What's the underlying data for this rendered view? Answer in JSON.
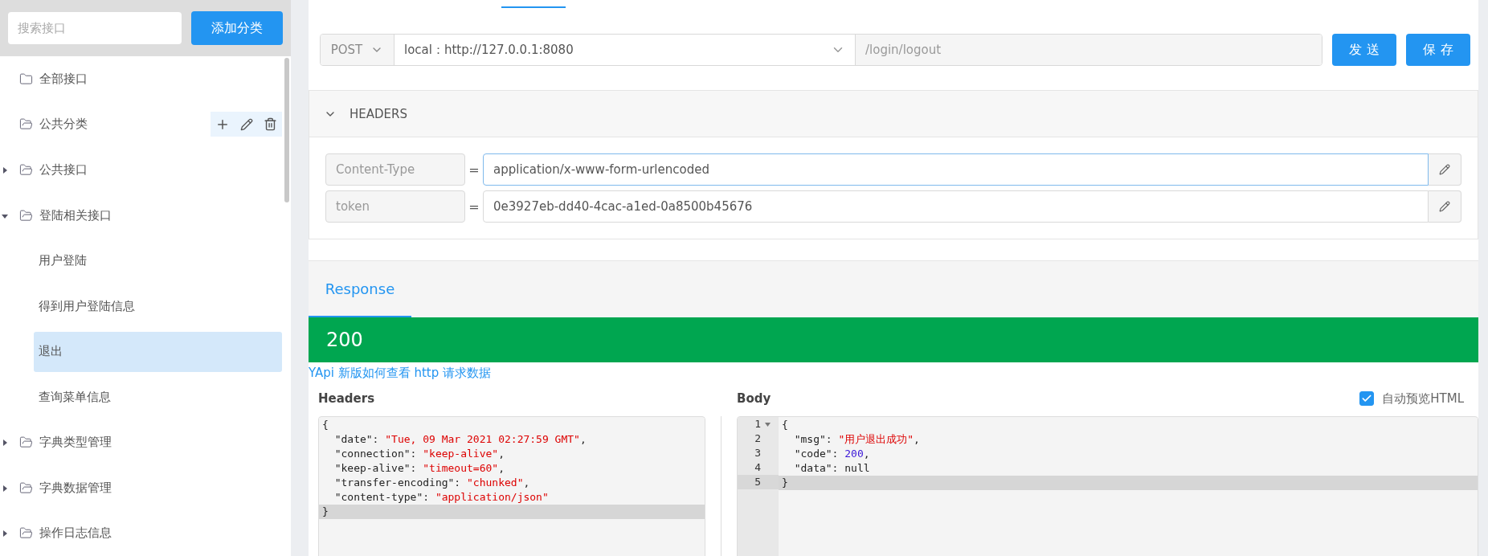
{
  "sidebar": {
    "search": {
      "placeholder": "搜索接口"
    },
    "add_button": "添加分类",
    "tree": [
      {
        "label": "全部接口",
        "kind": "all",
        "selected": false
      },
      {
        "label": "公共分类",
        "kind": "category",
        "selected": false,
        "hovered": true
      },
      {
        "label": "公共接口",
        "kind": "category",
        "selected": false,
        "expanded": false
      },
      {
        "label": "登陆相关接口",
        "kind": "category",
        "selected": false,
        "expanded": true,
        "children": [
          {
            "label": "用户登陆",
            "selected": false
          },
          {
            "label": "得到用户登陆信息",
            "selected": false
          },
          {
            "label": "退出",
            "selected": true
          },
          {
            "label": "查询菜单信息",
            "selected": false
          }
        ]
      },
      {
        "label": "字典类型管理",
        "kind": "category",
        "selected": false,
        "expanded": false
      },
      {
        "label": "字典数据管理",
        "kind": "category",
        "selected": false,
        "expanded": false
      },
      {
        "label": "操作日志信息",
        "kind": "category",
        "selected": false,
        "expanded": false
      }
    ]
  },
  "request": {
    "method": "POST",
    "environment": "local：http://127.0.0.1:8080",
    "path": "/login/logout",
    "buttons": [
      "发 送",
      "保 存"
    ]
  },
  "headers": {
    "title": "HEADERS",
    "expanded": true,
    "rows": [
      {
        "name": "Content-Type",
        "separator": "=",
        "value": "application/x-www-form-urlencoded",
        "focused": true
      },
      {
        "name": "token",
        "separator": "=",
        "value": "0e3927eb-dd40-4cac-a1ed-0a8500b45676",
        "focused": false
      }
    ]
  },
  "response": {
    "tab": {
      "label": "Response",
      "selected": true
    },
    "status": "200",
    "help_link": "YApi 新版如何查看 http 请求数据",
    "headers_title": "Headers",
    "headers_code": [
      {
        "active": false,
        "tokens": [
          {
            "kind": "plain",
            "text": "{"
          }
        ]
      },
      {
        "active": false,
        "tokens": [
          {
            "kind": "plain",
            "text": "  \"date\": "
          },
          {
            "kind": "string",
            "text": "\"Tue, 09 Mar 2021 02:27:59 GMT\""
          },
          {
            "kind": "plain",
            "text": ","
          }
        ]
      },
      {
        "active": false,
        "tokens": [
          {
            "kind": "plain",
            "text": "  \"connection\": "
          },
          {
            "kind": "string",
            "text": "\"keep-alive\""
          },
          {
            "kind": "plain",
            "text": ","
          }
        ]
      },
      {
        "active": false,
        "tokens": [
          {
            "kind": "plain",
            "text": "  \"keep-alive\": "
          },
          {
            "kind": "string",
            "text": "\"timeout=60\""
          },
          {
            "kind": "plain",
            "text": ","
          }
        ]
      },
      {
        "active": false,
        "tokens": [
          {
            "kind": "plain",
            "text": "  \"transfer-encoding\": "
          },
          {
            "kind": "string",
            "text": "\"chunked\""
          },
          {
            "kind": "plain",
            "text": ","
          }
        ]
      },
      {
        "active": false,
        "tokens": [
          {
            "kind": "plain",
            "text": "  \"content-type\": "
          },
          {
            "kind": "string",
            "text": "\"application/json\""
          }
        ]
      },
      {
        "active": true,
        "tokens": [
          {
            "kind": "plain",
            "text": "}"
          }
        ]
      }
    ],
    "body_title": "Body",
    "preview": {
      "label": "自动预览HTML",
      "checked": true
    },
    "body_code": [
      {
        "number": "1",
        "active": false,
        "foldable": true,
        "tokens": [
          {
            "kind": "plain",
            "text": "{"
          }
        ]
      },
      {
        "number": "2",
        "active": false,
        "tokens": [
          {
            "kind": "plain",
            "text": "  \"msg\": "
          },
          {
            "kind": "string",
            "text": "\"用户退出成功\""
          },
          {
            "kind": "plain",
            "text": ","
          }
        ]
      },
      {
        "number": "3",
        "active": false,
        "tokens": [
          {
            "kind": "plain",
            "text": "  \"code\": "
          },
          {
            "kind": "number",
            "text": "200"
          },
          {
            "kind": "plain",
            "text": ","
          }
        ]
      },
      {
        "number": "4",
        "active": false,
        "tokens": [
          {
            "kind": "plain",
            "text": "  \"data\": null"
          }
        ]
      },
      {
        "number": "5",
        "active": true,
        "tokens": [
          {
            "kind": "plain",
            "text": "}"
          }
        ]
      }
    ]
  }
}
